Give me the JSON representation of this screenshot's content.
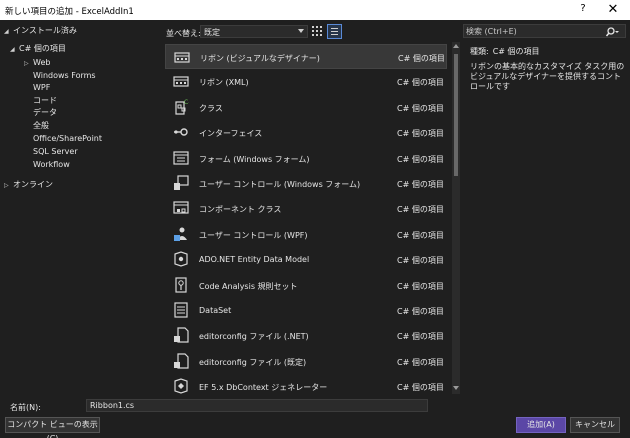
{
  "window": {
    "title": "新しい項目の追加 - ExcelAddIn1",
    "help": "?",
    "close": "✕"
  },
  "tree": {
    "installed": "インストール済み",
    "csharp_items": "C# 個の項目",
    "children": [
      "Web",
      "Windows Forms",
      "WPF",
      "コード",
      "データ",
      "全般",
      "Office/SharePoint",
      "SQL Server",
      "Workflow"
    ],
    "online": "オンライン"
  },
  "toolbar": {
    "sort_label": "並べ替え:",
    "sort_value": "既定"
  },
  "search": {
    "placeholder": "検索 (Ctrl+E)"
  },
  "items": [
    {
      "name": "リボン (ビジュアルなデザイナー)",
      "type": "C# 個の項目",
      "icon": "ribbon-designer-icon"
    },
    {
      "name": "リボン (XML)",
      "type": "C# 個の項目",
      "icon": "ribbon-xml-icon"
    },
    {
      "name": "クラス",
      "type": "C# 個の項目",
      "icon": "class-icon"
    },
    {
      "name": "インターフェイス",
      "type": "C# 個の項目",
      "icon": "interface-icon"
    },
    {
      "name": "フォーム (Windows フォーム)",
      "type": "C# 個の項目",
      "icon": "windows-form-icon"
    },
    {
      "name": "ユーザー コントロール (Windows フォーム)",
      "type": "C# 個の項目",
      "icon": "user-control-icon"
    },
    {
      "name": "コンポーネント クラス",
      "type": "C# 個の項目",
      "icon": "component-class-icon"
    },
    {
      "name": "ユーザー コントロール (WPF)",
      "type": "C# 個の項目",
      "icon": "wpf-user-control-icon"
    },
    {
      "name": "ADO.NET Entity Data Model",
      "type": "C# 個の項目",
      "icon": "entity-data-model-icon"
    },
    {
      "name": "Code Analysis 規則セット",
      "type": "C# 個の項目",
      "icon": "code-analysis-icon"
    },
    {
      "name": "DataSet",
      "type": "C# 個の項目",
      "icon": "dataset-icon"
    },
    {
      "name": "editorconfig ファイル (.NET)",
      "type": "C# 個の項目",
      "icon": "editorconfig-icon"
    },
    {
      "name": "editorconfig ファイル (既定)",
      "type": "C# 個の項目",
      "icon": "editorconfig-icon"
    },
    {
      "name": "EF 5.x DbContext ジェネレーター",
      "type": "C# 個の項目",
      "icon": "ef-generator-icon"
    }
  ],
  "details": {
    "type_label": "種類:",
    "type_value": "C# 個の項目",
    "description": "リボンの基本的なカスタマイズ タスク用のビジュアルなデザイナーを提供するコントロールです"
  },
  "bottom": {
    "name_label": "名前(N):",
    "name_value": "Ribbon1.cs",
    "compact_label": "コンパクト ビューの表示(C)",
    "add_label": "追加(A)",
    "cancel_label": "キャンセル"
  },
  "colors": {
    "background": "#1f1f1f",
    "selected_row": "#383838",
    "primary_button": "#5b47a6",
    "icon_stroke": "#d8d8d8",
    "icon_accent": "#5ca0e6",
    "icon_green": "#6fbf5a"
  }
}
